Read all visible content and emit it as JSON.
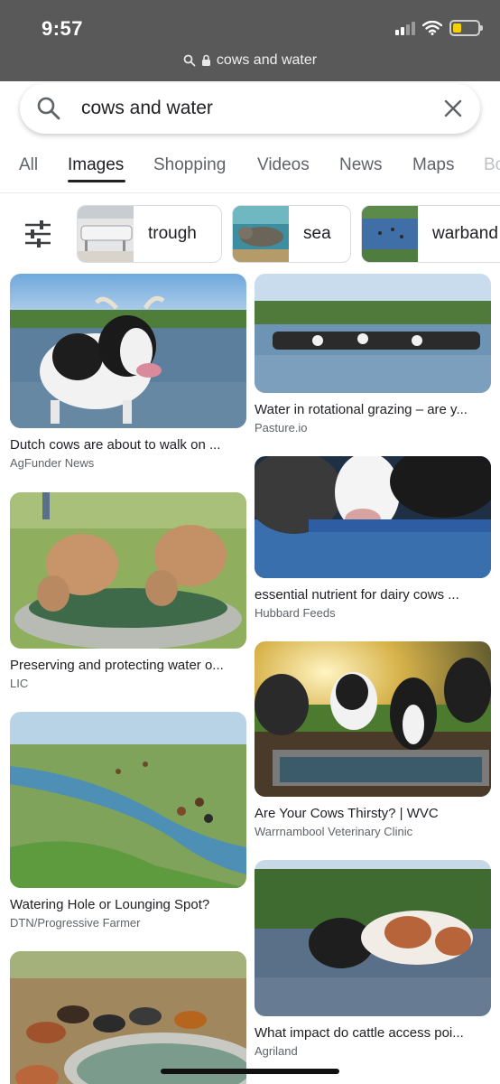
{
  "status_bar": {
    "time": "9:57"
  },
  "browser": {
    "url_text": "cows and water"
  },
  "search": {
    "query": "cows and water"
  },
  "tabs": [
    {
      "label": "All"
    },
    {
      "label": "Images"
    },
    {
      "label": "Shopping"
    },
    {
      "label": "Videos"
    },
    {
      "label": "News"
    },
    {
      "label": "Maps"
    },
    {
      "label": "Bo"
    }
  ],
  "chips": [
    {
      "label": "trough"
    },
    {
      "label": "sea"
    },
    {
      "label": "warband"
    }
  ],
  "results_left": [
    {
      "title": "Dutch cows are about to walk on ...",
      "source": "AgFunder News"
    },
    {
      "title": "Preserving and protecting water o...",
      "source": "LIC"
    },
    {
      "title": "Watering Hole or Lounging Spot?",
      "source": "DTN/Progressive Farmer"
    },
    {
      "title": "",
      "source": ""
    }
  ],
  "results_right": [
    {
      "title": "Water in rotational grazing – are y...",
      "source": "Pasture.io"
    },
    {
      "title": "essential nutrient for dairy cows ...",
      "source": "Hubbard Feeds"
    },
    {
      "title": "Are Your Cows Thirsty? | WVC",
      "source": "Warrnambool Veterinary Clinic"
    },
    {
      "title": "What impact do cattle access poi...",
      "source": "Agriland"
    }
  ]
}
